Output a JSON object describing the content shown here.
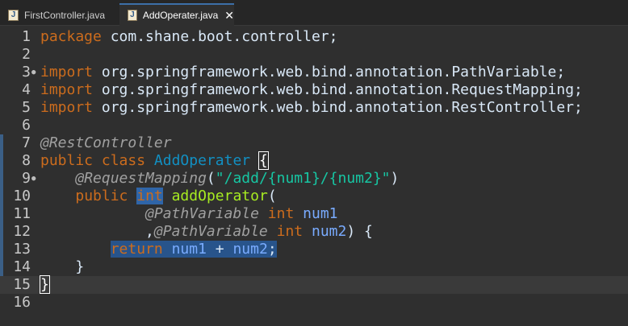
{
  "tabs": [
    {
      "label": "FirstController.java",
      "active": false
    },
    {
      "label": "AddOperater.java",
      "active": true
    }
  ],
  "colors": {
    "background": "#2f2f2f",
    "keyword": "#cc6c1d",
    "annotation": "#a0a0a0",
    "string": "#17c6a3",
    "class_name": "#1290c3",
    "variable": "#79abff",
    "selection": "#2f65a8"
  },
  "editor": {
    "lines": [
      {
        "n": "1",
        "tokens": [
          {
            "t": "package",
            "c": "kw"
          },
          {
            "t": " com.shane.boot.controller;",
            "c": "plain"
          }
        ]
      },
      {
        "n": "2",
        "tokens": []
      },
      {
        "n": "3",
        "fold": "●",
        "tokens": [
          {
            "t": "import",
            "c": "kw"
          },
          {
            "t": " org.springframework.web.bind.annotation.PathVariable;",
            "c": "plain"
          }
        ]
      },
      {
        "n": "4",
        "tokens": [
          {
            "t": "import",
            "c": "kw"
          },
          {
            "t": " org.springframework.web.bind.annotation.RequestMapping;",
            "c": "plain"
          }
        ]
      },
      {
        "n": "5",
        "tokens": [
          {
            "t": "import",
            "c": "kw"
          },
          {
            "t": " org.springframework.web.bind.annotation.RestController;",
            "c": "plain"
          }
        ]
      },
      {
        "n": "6",
        "tokens": []
      },
      {
        "n": "7",
        "marker": true,
        "tokens": [
          {
            "t": "@RestController",
            "c": "ann"
          }
        ]
      },
      {
        "n": "8",
        "marker": true,
        "tokens": [
          {
            "t": "public",
            "c": "kw"
          },
          {
            "t": " ",
            "c": "plain"
          },
          {
            "t": "class",
            "c": "kw"
          },
          {
            "t": " ",
            "c": "plain"
          },
          {
            "t": "AddOperater",
            "c": "cls"
          },
          {
            "t": " ",
            "c": "plain"
          },
          {
            "t": "{",
            "c": "bracket"
          }
        ]
      },
      {
        "n": "9",
        "fold": "●",
        "marker": true,
        "tokens": [
          {
            "t": "    ",
            "c": "plain"
          },
          {
            "t": "@RequestMapping",
            "c": "ann"
          },
          {
            "t": "(",
            "c": "plain"
          },
          {
            "t": "\"/add/{num1}/{num2}\"",
            "c": "str"
          },
          {
            "t": ")",
            "c": "plain"
          }
        ]
      },
      {
        "n": "10",
        "marker": true,
        "tokens": [
          {
            "t": "    ",
            "c": "plain"
          },
          {
            "t": "public",
            "c": "kw"
          },
          {
            "t": " ",
            "c": "plain"
          },
          {
            "t": "int",
            "c": "kw sel"
          },
          {
            "t": " ",
            "c": "plain"
          },
          {
            "t": "addOperator",
            "c": "fn"
          },
          {
            "t": "(",
            "c": "plain"
          }
        ]
      },
      {
        "n": "11",
        "marker": true,
        "tokens": [
          {
            "t": "            ",
            "c": "plain"
          },
          {
            "t": "@PathVariable",
            "c": "ann"
          },
          {
            "t": " ",
            "c": "plain"
          },
          {
            "t": "int",
            "c": "kw"
          },
          {
            "t": " ",
            "c": "plain"
          },
          {
            "t": "num1",
            "c": "var"
          }
        ]
      },
      {
        "n": "12",
        "marker": true,
        "tokens": [
          {
            "t": "            ,",
            "c": "plain"
          },
          {
            "t": "@PathVariable",
            "c": "ann"
          },
          {
            "t": " ",
            "c": "plain"
          },
          {
            "t": "int",
            "c": "kw"
          },
          {
            "t": " ",
            "c": "plain"
          },
          {
            "t": "num2",
            "c": "var"
          },
          {
            "t": ") {",
            "c": "plain"
          }
        ]
      },
      {
        "n": "13",
        "marker": true,
        "tokens": [
          {
            "t": "        ",
            "c": "plain"
          },
          {
            "t": "return",
            "c": "kw sel2"
          },
          {
            "t": " ",
            "c": "sel2"
          },
          {
            "t": "num1",
            "c": "var sel2"
          },
          {
            "t": " + ",
            "c": "sel2"
          },
          {
            "t": "num2",
            "c": "var sel2"
          },
          {
            "t": ";",
            "c": "sel2"
          }
        ]
      },
      {
        "n": "14",
        "marker": true,
        "tokens": [
          {
            "t": "    }",
            "c": "plain"
          }
        ]
      },
      {
        "n": "15",
        "current": true,
        "caret": true,
        "tokens": [
          {
            "t": "}",
            "c": "bracket"
          }
        ]
      },
      {
        "n": "16",
        "tokens": []
      }
    ]
  }
}
